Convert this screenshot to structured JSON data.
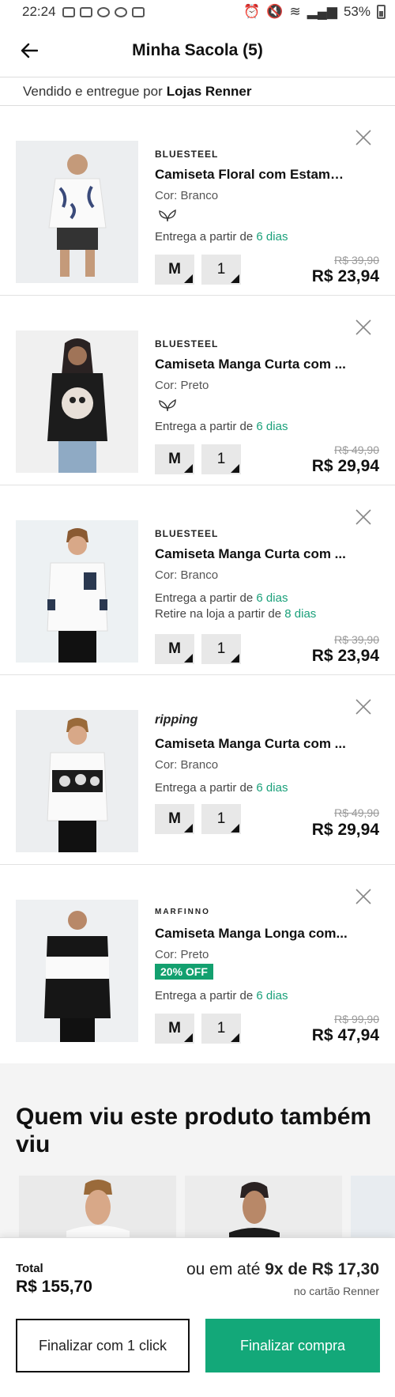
{
  "status_bar": {
    "time": "22:24",
    "battery": "53%"
  },
  "header": {
    "title": "Minha Sacola (5)"
  },
  "seller": {
    "prefix": "Vendido e entregue por",
    "name": "Lojas Renner"
  },
  "items": [
    {
      "brand": "BLUESTEEL",
      "name": "Camiseta Floral com Estamp...",
      "color": "Cor: Branco",
      "eco": true,
      "delivery_prefix": "Entrega a partir de",
      "delivery_days": "6 dias",
      "size": "M",
      "qty": "1",
      "old_price": "R$ 39,90",
      "price": "R$ 23,94"
    },
    {
      "brand": "BLUESTEEL",
      "name": "Camiseta Manga Curta com ...",
      "color": "Cor: Preto",
      "eco": true,
      "delivery_prefix": "Entrega a partir de",
      "delivery_days": "6 dias",
      "size": "M",
      "qty": "1",
      "old_price": "R$ 49,90",
      "price": "R$ 29,94"
    },
    {
      "brand": "BLUESTEEL",
      "name": "Camiseta Manga Curta com ...",
      "color": "Cor: Branco",
      "eco": false,
      "delivery_prefix": "Entrega a partir de",
      "delivery_days": "6 dias",
      "pickup_prefix": "Retire na loja a partir de",
      "pickup_days": "8 dias",
      "size": "M",
      "qty": "1",
      "old_price": "R$ 39,90",
      "price": "R$ 23,94"
    },
    {
      "brand": "ripping",
      "name": "Camiseta Manga Curta com ...",
      "color": "Cor: Branco",
      "eco": false,
      "delivery_prefix": "Entrega a partir de",
      "delivery_days": "6 dias",
      "size": "M",
      "qty": "1",
      "old_price": "R$ 49,90",
      "price": "R$ 29,94"
    },
    {
      "brand": "MARFINNO",
      "name": "Camiseta Manga Longa com...",
      "color": "Cor: Preto",
      "badge": "20% OFF",
      "delivery_prefix": "Entrega a partir de",
      "delivery_days": "6 dias",
      "size": "M",
      "qty": "1",
      "old_price": "R$ 99,90",
      "price": "R$ 47,94"
    }
  ],
  "recommend": {
    "title": "Quem viu este produto também viu"
  },
  "footer": {
    "total_label": "Total",
    "total_value": "R$ 155,70",
    "install_prefix": "ou em até",
    "install_value": "9x de R$ 17,30",
    "card_note": "no cartão Renner",
    "one_click_label": "Finalizar com 1 click",
    "checkout_label": "Finalizar compra"
  },
  "colors": {
    "accent": "#13a879",
    "delivery_green": "#1aa07a"
  }
}
